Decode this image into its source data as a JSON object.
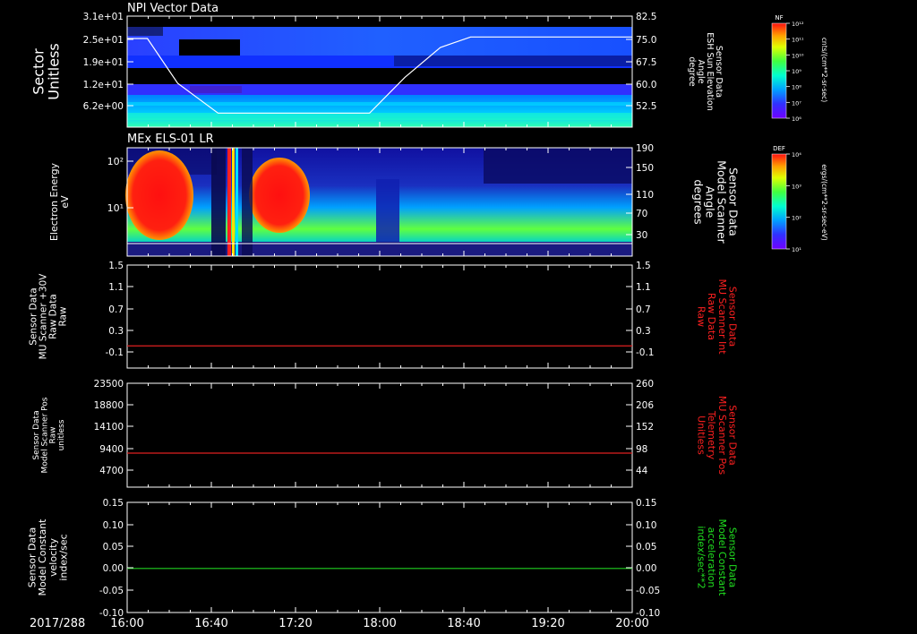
{
  "date_label": "2017/288",
  "time_ticks": [
    "16:00",
    "16:40",
    "17:20",
    "18:00",
    "18:40",
    "19:20",
    "20:00"
  ],
  "colors": {
    "red_line": "#e02020",
    "green_line": "#20d020",
    "red_text": "#ff2020",
    "green_text": "#20e020"
  },
  "chart_data": [
    {
      "type": "heatmap",
      "title": "NPI Vector Data",
      "ylabel": "Sector Unitless",
      "y_ticks": [
        "3.1e+01",
        "2.5e+01",
        "1.9e+01",
        "1.2e+01",
        "6.2e+00"
      ],
      "right_ylabel": [
        "Sensor Data",
        "ESH Sun Elevation",
        "Angle",
        "degree"
      ],
      "right_ticks": [
        "82.5",
        "75.0",
        "67.5",
        "60.0",
        "52.5"
      ],
      "colorbar_label": "NF",
      "colorbar_units": "cnts/(cm**2-sr-sec)",
      "colorbar_ticks": [
        "10¹²",
        "10¹¹",
        "10¹⁰",
        "10⁹",
        "10⁸",
        "10⁷",
        "10⁶"
      ],
      "overlay_angle": [
        [
          0,
          75
        ],
        [
          4,
          75
        ],
        [
          10,
          60
        ],
        [
          18,
          50
        ],
        [
          30,
          50
        ],
        [
          40,
          50
        ],
        [
          48,
          50
        ],
        [
          55,
          62
        ],
        [
          62,
          72
        ],
        [
          68,
          75.5
        ],
        [
          100,
          75.5
        ]
      ]
    },
    {
      "type": "heatmap",
      "title": "MEx ELS-01 LR",
      "ylabel": [
        "Electron Energy",
        "eV"
      ],
      "y_ticks": [
        "10²",
        "10¹"
      ],
      "right_ylabel": [
        "Sensor Data",
        "Model Scanner",
        "Angle",
        "degrees"
      ],
      "right_ticks": [
        "190",
        "150",
        "110",
        "70",
        "30"
      ],
      "colorbar_label": "DEF",
      "colorbar_units": "ergs/(cm**2-sr-sec-eV)",
      "colorbar_ticks": [
        "10⁴",
        "10³",
        "10²",
        "10¹"
      ]
    },
    {
      "type": "line",
      "ylabel": [
        "Sensor Data",
        "MU Scanner +30V",
        "Raw Data",
        "Raw"
      ],
      "right_ylabel": [
        "Sensor Data",
        "MU Scanner Int",
        "Raw Data",
        "Raw"
      ],
      "y_ticks": [
        "1.5",
        "1.1",
        "0.7",
        "0.3",
        "-0.1"
      ],
      "right_ticks": [
        "1.5",
        "1.1",
        "0.7",
        "0.3",
        "-0.1"
      ],
      "ylim": [
        -0.5,
        1.5
      ],
      "series": [
        {
          "x": [
            16.0,
            20.0
          ],
          "y": [
            -0.07,
            -0.07
          ]
        }
      ]
    },
    {
      "type": "line",
      "ylabel": [
        "Sensor Data",
        "Model Scanner Pos",
        "Raw",
        "unitless"
      ],
      "right_ylabel": [
        "Sensor Data",
        "MU Scanner Pos",
        "Telemetry",
        "Unitless"
      ],
      "y_ticks": [
        "23500",
        "18800",
        "14100",
        "9400",
        "4700"
      ],
      "right_ticks": [
        "260",
        "206",
        "152",
        "98",
        "44"
      ],
      "ylim": [
        0,
        23500
      ],
      "series": [
        {
          "x": [
            16.0,
            20.0
          ],
          "y": [
            7700,
            7700
          ]
        }
      ]
    },
    {
      "type": "line",
      "ylabel": [
        "Sensor Data",
        "Model Constant",
        "velocity",
        "index/sec"
      ],
      "right_ylabel": [
        "Sensor Data",
        "Model Constant",
        "acceleration",
        "index/sec**2"
      ],
      "y_ticks": [
        "0.15",
        "0.10",
        "0.05",
        "0.00",
        "-0.05",
        "-0.10"
      ],
      "right_ticks": [
        "0.15",
        "0.10",
        "0.05",
        "0.00",
        "-0.05",
        "-0.10"
      ],
      "ylim": [
        -0.1,
        0.15
      ],
      "series": [
        {
          "x": [
            16.0,
            20.0
          ],
          "y": [
            0.0,
            0.0
          ]
        }
      ]
    }
  ]
}
